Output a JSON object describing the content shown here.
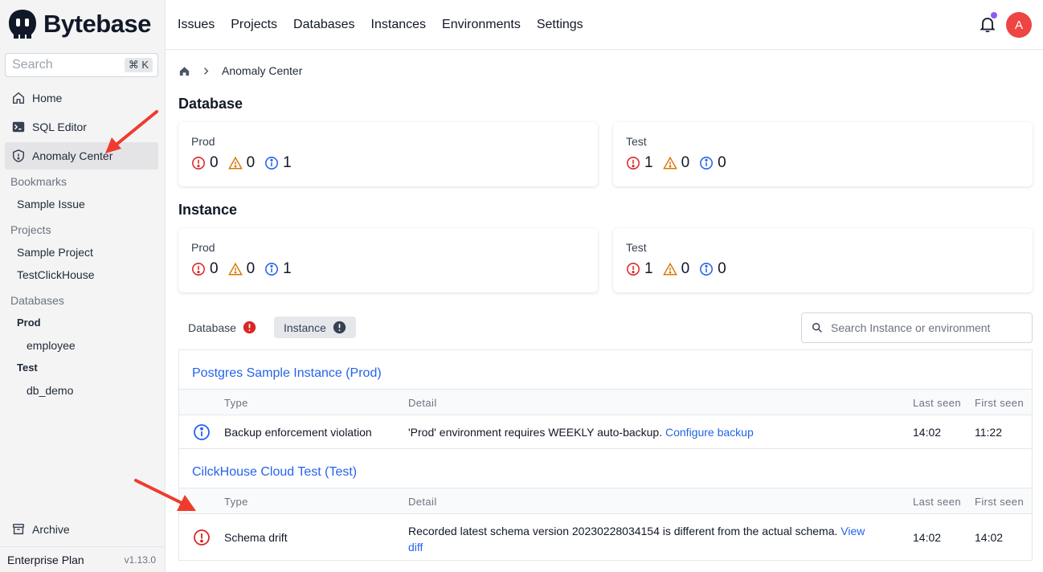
{
  "brand": {
    "name": "Bytebase"
  },
  "sidebar": {
    "search_placeholder": "Search",
    "shortcut": "⌘ K",
    "nav": [
      {
        "label": "Home",
        "icon": "home-icon"
      },
      {
        "label": "SQL Editor",
        "icon": "terminal-icon"
      },
      {
        "label": "Anomaly Center",
        "icon": "shield-icon",
        "active": true
      }
    ],
    "bookmarks_title": "Bookmarks",
    "bookmarks": [
      "Sample Issue"
    ],
    "projects_title": "Projects",
    "projects": [
      "Sample Project",
      "TestClickHouse"
    ],
    "databases_title": "Databases",
    "databases": [
      {
        "env": "Prod",
        "items": [
          "employee"
        ]
      },
      {
        "env": "Test",
        "items": [
          "db_demo"
        ]
      }
    ],
    "archive": "Archive",
    "plan": "Enterprise Plan",
    "version": "v1.13.0"
  },
  "topnav": [
    "Issues",
    "Projects",
    "Databases",
    "Instances",
    "Environments",
    "Settings"
  ],
  "user": {
    "avatar_initial": "A"
  },
  "breadcrumb": {
    "current": "Anomaly Center"
  },
  "database_section": {
    "title": "Database",
    "cards": [
      {
        "env": "Prod",
        "error": "0",
        "warning": "0",
        "info": "1"
      },
      {
        "env": "Test",
        "error": "1",
        "warning": "0",
        "info": "0"
      }
    ]
  },
  "instance_section": {
    "title": "Instance",
    "cards": [
      {
        "env": "Prod",
        "error": "0",
        "warning": "0",
        "info": "1"
      },
      {
        "env": "Test",
        "error": "1",
        "warning": "0",
        "info": "0"
      }
    ]
  },
  "tabs": [
    {
      "label": "Database",
      "active": false
    },
    {
      "label": "Instance",
      "active": true
    }
  ],
  "filter": {
    "placeholder": "Search Instance or environment"
  },
  "table": {
    "columns": {
      "type": "Type",
      "detail": "Detail",
      "last_seen": "Last seen",
      "first_seen": "First seen"
    },
    "groups": [
      {
        "title": "Postgres Sample Instance (Prod)",
        "rows": [
          {
            "severity": "info",
            "type": "Backup enforcement violation",
            "detail": "'Prod' environment requires WEEKLY auto-backup.",
            "link": "Configure backup",
            "last_seen": "14:02",
            "first_seen": "11:22"
          }
        ]
      },
      {
        "title": "CilckHouse Cloud Test (Test)",
        "rows": [
          {
            "severity": "error",
            "type": "Schema drift",
            "detail": "Recorded latest schema version 20230228034154 is different from the actual schema.",
            "link_line1": "View",
            "link_line2": "diff",
            "last_seen": "14:02",
            "first_seen": "14:02"
          }
        ]
      }
    ]
  },
  "colors": {
    "accent": "#2563eb",
    "error": "#dc2626",
    "warning": "#d97706",
    "info": "#2563eb",
    "annotation": "#ef3b2d"
  }
}
